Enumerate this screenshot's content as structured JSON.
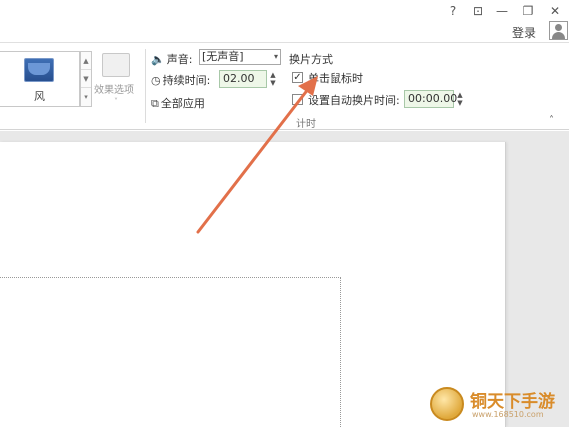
{
  "titlebar": {
    "help_icon": "?",
    "restore_ribbon_icon": "⊡",
    "minimize_icon": "—",
    "maximize_icon": "❐",
    "close_icon": "✕",
    "login_label": "登录"
  },
  "ribbon": {
    "gallery": {
      "selected_label": "风"
    },
    "effects": {
      "label": "效果选项"
    },
    "timing": {
      "sound_label": "声音:",
      "sound_value": "[无声音]",
      "duration_label": "持续时间:",
      "duration_value": "02.00",
      "apply_all_label": "全部应用"
    },
    "advance": {
      "title": "换片方式",
      "on_click_label": "单击鼠标时",
      "on_click_checked": true,
      "after_label": "设置自动换片时间:",
      "after_checked": false,
      "after_value": "00:00.00",
      "group_label": "计时"
    }
  },
  "watermark": {
    "text": "铜天下手游",
    "url": "www.168510.com"
  },
  "colors": {
    "annotation_arrow": "#e2704a",
    "spin_bg": "#eef7e8"
  }
}
